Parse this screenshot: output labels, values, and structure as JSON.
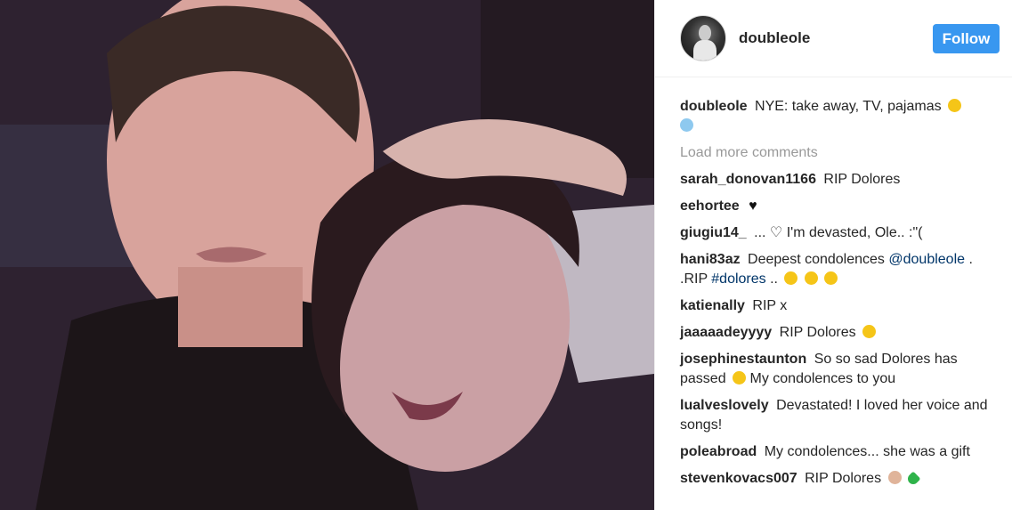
{
  "post": {
    "username": "doubleole",
    "follow_label": "Follow",
    "caption_user": "doubleole",
    "caption_text": "NYE: take away, TV, pajamas",
    "load_more_label": "Load more comments"
  },
  "comments": [
    {
      "user": "sarah_donovan1166",
      "text": "RIP Dolores"
    },
    {
      "user": "eehortee",
      "text": ""
    },
    {
      "user": "giugiu14_",
      "text": "... ♡ I'm devasted, Ole.. :\"("
    },
    {
      "user": "hani83az",
      "text": "Deepest condolences",
      "tag1": "@doubleole",
      "text2": ". .RIP",
      "tag2": "#dolores",
      "text3": ".."
    },
    {
      "user": "katienally",
      "text": "RIP x"
    },
    {
      "user": "jaaaaadeyyyy",
      "text": "RIP Dolores"
    },
    {
      "user": "josephinestaunton",
      "text": "So so sad Dolores has passed",
      "text2": "My condolences to you"
    },
    {
      "user": "lualveslovely",
      "text": "Devastated! I loved her voice and songs!"
    },
    {
      "user": "poleabroad",
      "text": "My condolences... she was a gift"
    },
    {
      "user": "stevenkovacs007",
      "text": "RIP Dolores"
    }
  ],
  "icons": {
    "caption_emoji": "grinning-face-emoji",
    "caption_emoji2": "ghost-emoji",
    "heart": "black-heart-icon"
  },
  "colors": {
    "follow_button": "#3897f0",
    "hashtag": "#003569",
    "muted": "#999999"
  }
}
